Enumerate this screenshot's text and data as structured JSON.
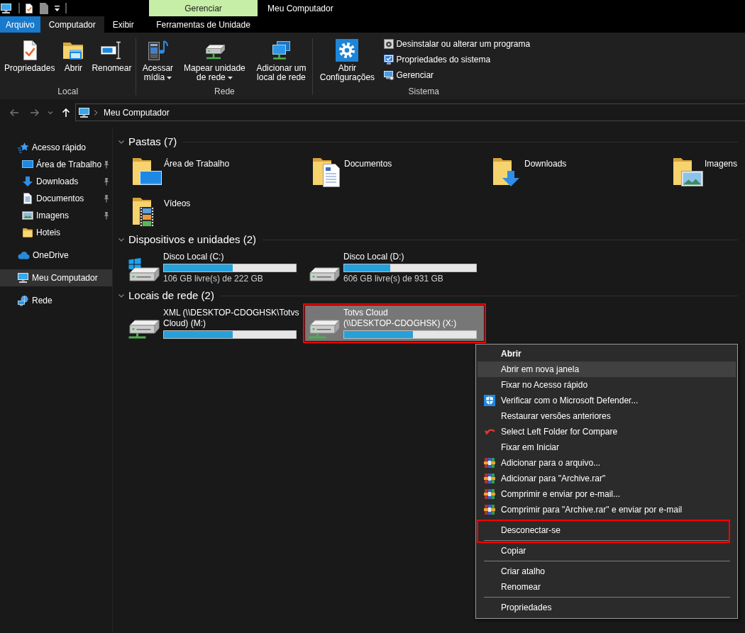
{
  "window": {
    "title": "Meu Computador"
  },
  "contextual_tab_group": {
    "label": "Gerenciar"
  },
  "ribbon_tabs": [
    {
      "label": "Arquivo",
      "kind": "file",
      "selected": false
    },
    {
      "label": "Computador",
      "kind": "standard",
      "selected": true
    },
    {
      "label": "Exibir",
      "kind": "standard",
      "selected": false
    },
    {
      "label": "Ferramentas de Unidade",
      "kind": "contextual",
      "selected": false
    }
  ],
  "ribbon_groups": [
    {
      "label": "Local",
      "buttons": [
        {
          "label": "Propriedades",
          "kind": "large",
          "dropdown": false
        },
        {
          "label": "Abrir",
          "kind": "large",
          "dropdown": false
        },
        {
          "label": "Renomear",
          "kind": "large",
          "dropdown": false
        }
      ]
    },
    {
      "label": "Rede",
      "buttons": [
        {
          "label": "Acessar mídia",
          "kind": "large",
          "dropdown": true
        },
        {
          "label": "Mapear unidade de rede",
          "kind": "large",
          "dropdown": true
        },
        {
          "label": "Adicionar um local de rede",
          "kind": "large",
          "dropdown": false
        }
      ]
    },
    {
      "label": "Sistema",
      "buttons": [
        {
          "label": "Abrir Configurações",
          "kind": "large",
          "dropdown": false
        },
        {
          "label": "Desinstalar ou alterar um programa",
          "kind": "small",
          "dropdown": false
        },
        {
          "label": "Propriedades do sistema",
          "kind": "small",
          "dropdown": false
        },
        {
          "label": "Gerenciar",
          "kind": "small",
          "dropdown": false
        }
      ]
    }
  ],
  "nav_buttons": [
    {
      "kind": "back",
      "disabled": true
    },
    {
      "kind": "forward",
      "disabled": true
    },
    {
      "kind": "recent",
      "disabled": true
    },
    {
      "kind": "up",
      "disabled": false
    }
  ],
  "address_bar": {
    "breadcrumbs": [
      {
        "label": "Meu Computador"
      }
    ]
  },
  "navigation_pane": {
    "items": [
      {
        "label": "Acesso rápido",
        "selected": false,
        "children": [
          {
            "label": "Área de Trabalho",
            "pinned": true,
            "selected": false
          },
          {
            "label": "Downloads",
            "pinned": true,
            "selected": false
          },
          {
            "label": "Documentos",
            "pinned": true,
            "selected": false
          },
          {
            "label": "Imagens",
            "pinned": true,
            "selected": false
          },
          {
            "label": "Hoteis",
            "pinned": false,
            "selected": false
          }
        ]
      },
      {
        "label": "OneDrive",
        "selected": false
      },
      {
        "label": "Meu Computador",
        "selected": true
      },
      {
        "label": "Rede",
        "selected": false
      }
    ]
  },
  "sections": [
    {
      "title": "Pastas (7)",
      "kind": "folders",
      "expanded": true,
      "items": [
        {
          "name": "Área de Trabalho",
          "selected": false
        },
        {
          "name": "Documentos",
          "selected": false
        },
        {
          "name": "Downloads",
          "selected": false
        },
        {
          "name": "Imagens",
          "selected": false
        },
        {
          "name": "Vídeos",
          "selected": false
        }
      ]
    },
    {
      "title": "Dispositivos e unidades (2)",
      "kind": "devices",
      "expanded": true,
      "items": [
        {
          "name": "Disco Local (C:)",
          "kind": "system",
          "level": 0.52,
          "free_space": "106 GB livre(s) de 222 GB",
          "selected": false,
          "highlighted": false
        },
        {
          "name": "Disco Local (D:)",
          "kind": "local",
          "level": 0.35,
          "free_space": "606 GB livre(s) de 931 GB",
          "selected": false,
          "highlighted": false
        }
      ]
    },
    {
      "title": "Locais de rede (2)",
      "kind": "devices",
      "expanded": true,
      "items": [
        {
          "name": "XML (\\\\DESKTOP-CDOGHSK\\Totvs Cloud) (M:)",
          "kind": "network",
          "level": 0.52,
          "selected": false,
          "highlighted": false
        },
        {
          "name": "Totvs Cloud (\\\\DESKTOP-CDOGHSK) (X:)",
          "kind": "network",
          "level": 0.52,
          "selected": true,
          "highlighted": true
        }
      ]
    }
  ],
  "context_menu": {
    "items": [
      {
        "kind": "item",
        "label": "Abrir",
        "default": true,
        "hovered": false,
        "highlighted": false
      },
      {
        "kind": "item",
        "label": "Abrir em nova janela",
        "default": false,
        "hovered": true,
        "highlighted": false
      },
      {
        "kind": "item",
        "label": "Fixar no Acesso rápido",
        "default": false,
        "hovered": false,
        "highlighted": false
      },
      {
        "kind": "item",
        "label": "Verificar com o Microsoft Defender...",
        "default": false,
        "hovered": false,
        "highlighted": false
      },
      {
        "kind": "item",
        "label": "Restaurar versões anteriores",
        "default": false,
        "hovered": false,
        "highlighted": false
      },
      {
        "kind": "item",
        "label": "Select Left Folder for Compare",
        "default": false,
        "hovered": false,
        "highlighted": false
      },
      {
        "kind": "item",
        "label": "Fixar em Iniciar",
        "default": false,
        "hovered": false,
        "highlighted": false
      },
      {
        "kind": "item",
        "label": "Adicionar para o arquivo...",
        "default": false,
        "hovered": false,
        "highlighted": false
      },
      {
        "kind": "item",
        "label": "Adicionar para \"Archive.rar\"",
        "default": false,
        "hovered": false,
        "highlighted": false
      },
      {
        "kind": "item",
        "label": "Comprimir e enviar por e-mail...",
        "default": false,
        "hovered": false,
        "highlighted": false
      },
      {
        "kind": "item",
        "label": "Comprimir para \"Archive.rar\" e enviar por e-mail",
        "default": false,
        "hovered": false,
        "highlighted": false
      },
      {
        "kind": "separator"
      },
      {
        "kind": "item",
        "label": "Desconectar-se",
        "default": false,
        "hovered": false,
        "highlighted": true
      },
      {
        "kind": "separator"
      },
      {
        "kind": "item",
        "label": "Copiar",
        "default": false,
        "hovered": false,
        "highlighted": false
      },
      {
        "kind": "separator"
      },
      {
        "kind": "item",
        "label": "Criar atalho",
        "default": false,
        "hovered": false,
        "highlighted": false
      },
      {
        "kind": "item",
        "label": "Renomear",
        "default": false,
        "hovered": false,
        "highlighted": false
      },
      {
        "kind": "separator"
      },
      {
        "kind": "item",
        "label": "Propriedades",
        "default": false,
        "hovered": false,
        "highlighted": false
      }
    ]
  }
}
